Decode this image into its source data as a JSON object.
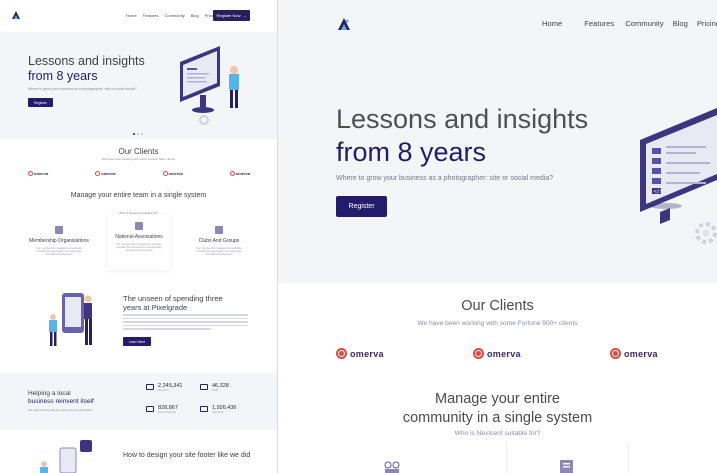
{
  "brand": {
    "accent": "#241b6b",
    "logo_icon": "triangle-logo-icon"
  },
  "nav": {
    "items": [
      "Home",
      "Features",
      "Community",
      "Blog",
      "Pricing"
    ],
    "register_label": "Register Now",
    "register_arrow_icon": "arrow-right-icon"
  },
  "hero": {
    "title_line1": "Lessons and insights",
    "title_line2": "from 8 years",
    "subtitle": "Where to grow your business as a photographer: site or social media?",
    "button_label": "Register"
  },
  "clients": {
    "title": "Our Clients",
    "subtitle": "We have been working with some Fortune 500+ clients",
    "logos": [
      "omerva",
      "omerva",
      "omerva"
    ]
  },
  "manage": {
    "title_left": "Manage your entire team in a single system",
    "title_right": "Manage your entire community in a single system",
    "subtitle": "Who is Nextcent suitable for?",
    "cards": [
      {
        "title": "Membership Organisations",
        "text": "Our membership management software provides full automation of membership renewals and payments"
      },
      {
        "title": "National Associations",
        "text": "Our membership management software provides full automation of membership renewals and payments"
      },
      {
        "title": "Clubs And Groups",
        "text": "Our membership management software provides full automation of membership renewals and payments"
      }
    ]
  },
  "unseen": {
    "title": "The unseen of spending three years at Pixelgrade",
    "button_label": "Learn More"
  },
  "stats": {
    "title_line1": "Helping a local",
    "title_line2": "business reinvent itself",
    "subtitle": "We reached here with our hard work and dedication",
    "items": [
      {
        "value": "2,245,341",
        "label": "Members",
        "icon": "members-icon"
      },
      {
        "value": "46,328",
        "label": "Clubs",
        "icon": "clubs-icon"
      },
      {
        "value": "828,867",
        "label": "Event Bookings",
        "icon": "bookings-icon"
      },
      {
        "value": "1,926,436",
        "label": "Payments",
        "icon": "payments-icon"
      }
    ]
  },
  "footer_section": {
    "title": "How to design your site footer like we did"
  }
}
